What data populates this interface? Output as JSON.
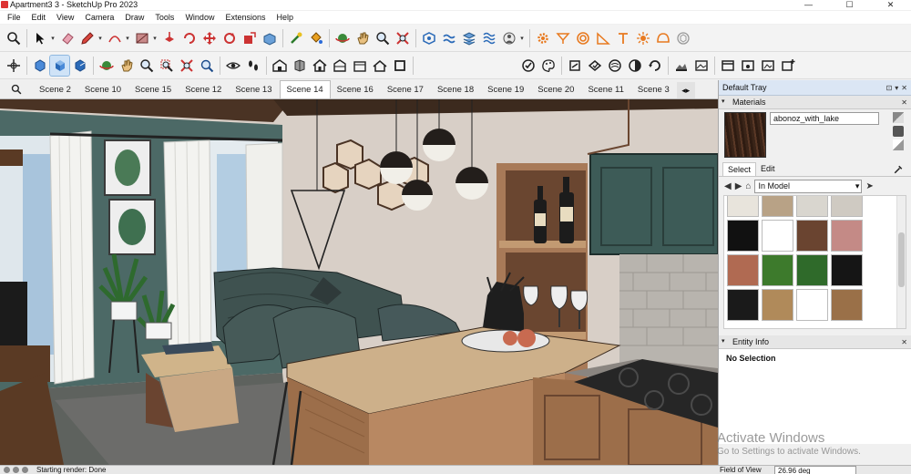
{
  "window": {
    "title": "Apartment3 3 - SketchUp Pro 2023",
    "minimize": "—",
    "maximize": "☐",
    "close": "✕"
  },
  "menu": [
    "File",
    "Edit",
    "View",
    "Camera",
    "Draw",
    "Tools",
    "Window",
    "Extensions",
    "Help"
  ],
  "toolbar_top": [
    "search",
    "select",
    "eraser",
    "pencil",
    "arc",
    "shape",
    "push-pull",
    "paint-bucket",
    "move",
    "rotate",
    "scale",
    "offset",
    "tape-measure",
    "paint",
    "follow-me",
    "orbit",
    "zoom",
    "zoom-extents",
    "sandbox",
    "smoove",
    "stamp",
    "drape",
    "add-location",
    "sun",
    "settings",
    "text",
    "axes",
    "dimensions",
    "section"
  ],
  "toolbar_second": [
    "axes",
    "cube-front",
    "cube-iso",
    "cube-back",
    "paint",
    "walk",
    "zoom",
    "zoom-window",
    "zoom-extents",
    "position-camera",
    "look-around",
    "footprints",
    "house",
    "component",
    "home",
    "roof",
    "window",
    "door",
    "square",
    "styles",
    "palette",
    "section-plane",
    "fog",
    "shadows",
    "layers",
    "outliner",
    "scenes",
    "scene-add"
  ],
  "scenes": {
    "tabs": [
      "Scene 2",
      "Scene 10",
      "Scene 15",
      "Scene 12",
      "Scene 13",
      "Scene 14",
      "Scene 16",
      "Scene 17",
      "Scene 18",
      "Scene 19",
      "Scene 20",
      "Scene 11",
      "Scene 3"
    ],
    "active": "Scene 14",
    "more": "◂▸"
  },
  "tray": {
    "title": "Default Tray",
    "materials": {
      "label": "Materials",
      "current_name": "abonoz_with_lake",
      "tabs": [
        "Select",
        "Edit"
      ],
      "active_tab": "Select",
      "library": "In Model",
      "thumbnails": [
        "#e8e4dc",
        "#b8a286",
        "#d9d6cf",
        "#cfcac2",
        "#111111",
        "#ffffff",
        "#6a4430",
        "#c48a86",
        "#b06a52",
        "#3d7a2c",
        "#2f6a2a",
        "#151515",
        "#1a1a1a",
        "#b08a5a",
        "#ffffff",
        "#9a7048"
      ]
    },
    "entity_info": {
      "label": "Entity Info",
      "value": "No Selection"
    }
  },
  "watermark": {
    "line1": "Activate Windows",
    "line2": "Go to Settings to activate Windows."
  },
  "status": {
    "message": "Starting render: Done",
    "fov_label": "Field of View",
    "fov_value": "26.96 deg"
  },
  "colors": {
    "accent": "#cfe3f7",
    "tray_header": "#dbe6f4"
  }
}
